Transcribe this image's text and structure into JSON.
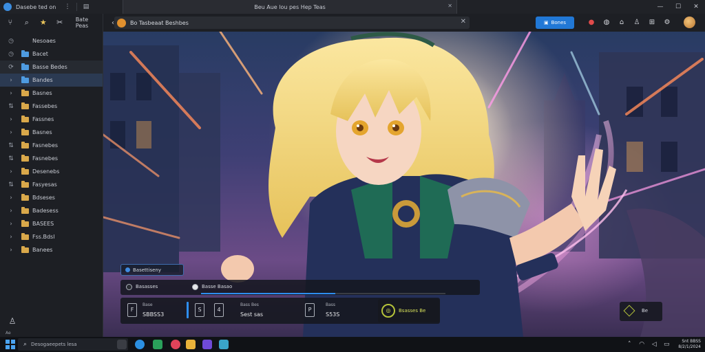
{
  "app": {
    "title": "Dasebe ted on",
    "tab_title": "Beu Aue lou pes Hep Teas",
    "window_controls": [
      "—",
      "☐",
      "✕"
    ]
  },
  "sidebar": {
    "toolbar_label": "Bate Peas",
    "items": [
      {
        "label": "Nesoaes",
        "icon": "clock-icon",
        "folder": "none",
        "state": ""
      },
      {
        "label": "Bacet",
        "icon": "clock-icon",
        "folder": "blue",
        "state": ""
      },
      {
        "label": "Basse Bedes",
        "icon": "refresh-icon",
        "folder": "blue",
        "state": "hover"
      },
      {
        "label": "Bandes",
        "icon": "chevron-right-icon",
        "folder": "blue",
        "state": "selected"
      },
      {
        "label": "Basnes",
        "icon": "chevron-right-icon",
        "folder": "yellow",
        "state": ""
      },
      {
        "label": "Fassebes",
        "icon": "expand-icon",
        "folder": "yellow",
        "state": ""
      },
      {
        "label": "Fassnes",
        "icon": "chevron-right-icon",
        "folder": "yellow",
        "state": ""
      },
      {
        "label": "Basnes",
        "icon": "chevron-right-icon",
        "folder": "yellow",
        "state": ""
      },
      {
        "label": "Fasnebes",
        "icon": "expand-icon",
        "folder": "yellow",
        "state": ""
      },
      {
        "label": "Fasnebes",
        "icon": "expand-icon",
        "folder": "yellow",
        "state": ""
      },
      {
        "label": "Desenebs",
        "icon": "chevron-right-icon",
        "folder": "yellow",
        "state": ""
      },
      {
        "label": "Fasyesas",
        "icon": "expand-icon",
        "folder": "yellow",
        "state": ""
      },
      {
        "label": "Bdseses",
        "icon": "chevron-right-icon",
        "folder": "yellow",
        "state": ""
      },
      {
        "label": "Badesess",
        "icon": "chevron-right-icon",
        "folder": "yellow",
        "state": ""
      },
      {
        "label": "BASEES",
        "icon": "chevron-right-icon",
        "folder": "yellow",
        "state": ""
      },
      {
        "label": "Fss.Bdsl",
        "icon": "chevron-right-icon",
        "folder": "yellow",
        "state": ""
      },
      {
        "label": "Banees",
        "icon": "chevron-right-icon",
        "folder": "yellow",
        "state": ""
      }
    ],
    "bottom_label": "Ae"
  },
  "toolbar": {
    "back_glyph": "‹",
    "address_text": "Bo Tasbeaat Beshbes",
    "close_glyph": "✕",
    "share_label": "Bones",
    "icons": [
      "alert-icon",
      "globe-icon",
      "home-icon",
      "user-icon",
      "grid-icon",
      "settings-icon"
    ]
  },
  "hud": {
    "badge_label": "Basettiseny",
    "bar": {
      "option1": "Basasses",
      "option2": "Basse Basao",
      "progress_pct": 55
    },
    "stats": [
      {
        "label": "Base",
        "value": "SBBSS3",
        "icon": "F"
      },
      {
        "label": "",
        "value": "",
        "icon": "S"
      },
      {
        "label": "",
        "value": "",
        "icon": "4"
      },
      {
        "label": "Bass Bes",
        "value": "Sest sas",
        "icon": ""
      },
      {
        "label": "Bass",
        "value": "S53S",
        "icon": "P"
      }
    ],
    "badge": {
      "text": "Bsasses Be",
      "glyph": "◎"
    },
    "corner": {
      "text": "Be"
    }
  },
  "taskbar": {
    "search_placeholder": "Desogaeepets lesa",
    "clock_time": "Snt BBSS",
    "clock_date": "8/2/1/2024"
  },
  "colors": {
    "accent": "#2178d6",
    "selected_row": "#2b3a52",
    "folder_yellow": "#d9a84a",
    "folder_blue": "#4e9be0",
    "badge_lime": "#b6c43a"
  }
}
